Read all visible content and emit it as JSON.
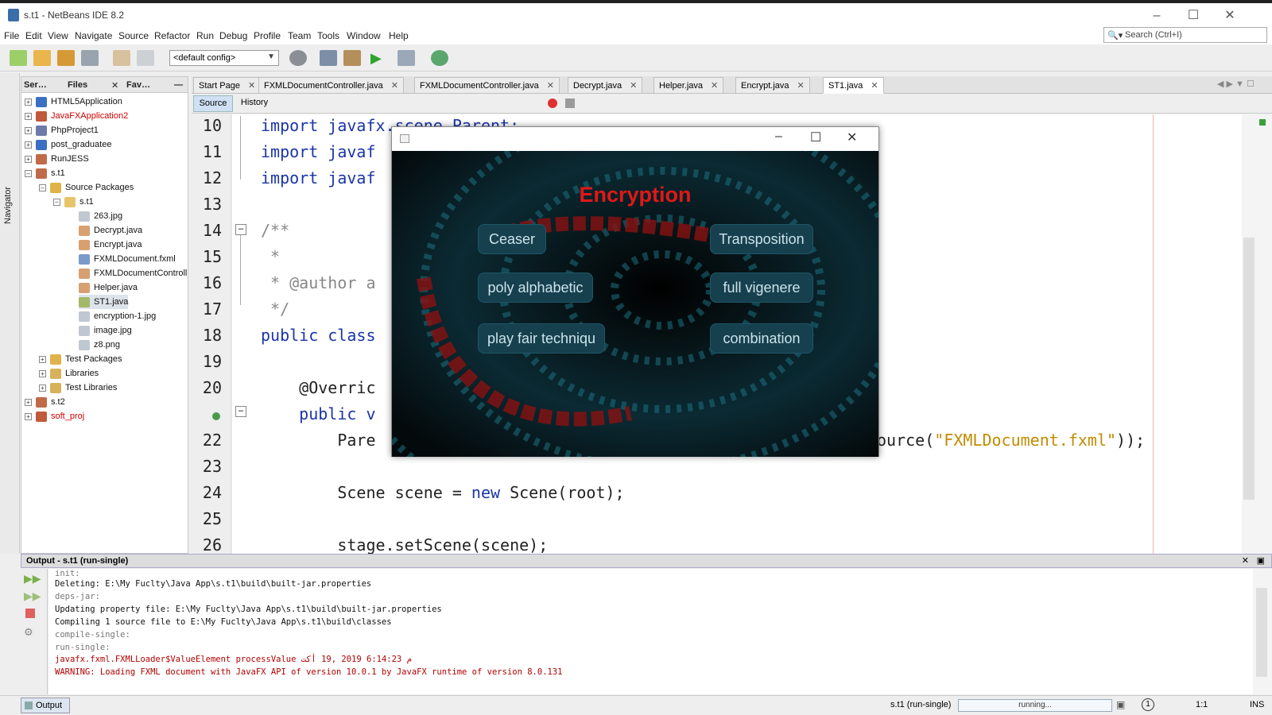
{
  "window": {
    "title": "s.t1 - NetBeans IDE 8.2"
  },
  "menu": [
    "File",
    "Edit",
    "View",
    "Navigate",
    "Source",
    "Refactor",
    "Run",
    "Debug",
    "Profile",
    "Team",
    "Tools",
    "Window",
    "Help"
  ],
  "search": {
    "placeholder": "Search (Ctrl+I)"
  },
  "toolbar": {
    "config": "<default config>"
  },
  "side": {
    "navigator": "Navigator"
  },
  "panel": {
    "tabs": [
      "Ser…",
      "Files",
      "Fav…"
    ]
  },
  "tree": [
    {
      "label": "HTML5Application",
      "red": false
    },
    {
      "label": "JavaFXApplication2",
      "red": true
    },
    {
      "label": "PhpProject1",
      "red": false
    },
    {
      "label": "post_graduatee",
      "red": false
    },
    {
      "label": "RunJESS",
      "red": false
    },
    {
      "label": "s.t1",
      "red": false
    },
    {
      "label": "Source Packages",
      "red": false
    },
    {
      "label": "s.t1",
      "red": false
    },
    {
      "label": "263.jpg",
      "red": false
    },
    {
      "label": "Decrypt.java",
      "red": false
    },
    {
      "label": "Encrypt.java",
      "red": false
    },
    {
      "label": "FXMLDocument.fxml",
      "red": false
    },
    {
      "label": "FXMLDocumentControll",
      "red": false
    },
    {
      "label": "Helper.java",
      "red": false
    },
    {
      "label": "ST1.java",
      "red": false
    },
    {
      "label": "encryption-1.jpg",
      "red": false
    },
    {
      "label": "image.jpg",
      "red": false
    },
    {
      "label": "z8.png",
      "red": false
    },
    {
      "label": "Test Packages",
      "red": false
    },
    {
      "label": "Libraries",
      "red": false
    },
    {
      "label": "Test Libraries",
      "red": false
    },
    {
      "label": "s.t2",
      "red": false
    },
    {
      "label": "soft_proj",
      "red": true
    }
  ],
  "editor": {
    "tabs": [
      "Start Page",
      "FXMLDocumentController.java",
      "FXMLDocumentController.java",
      "Decrypt.java",
      "Helper.java",
      "Encrypt.java",
      "ST1.java"
    ],
    "source_label": "Source",
    "history_label": "History",
    "line_numbers": [
      "10",
      "11",
      "12",
      "13",
      "14",
      "15",
      "16",
      "17",
      "18",
      "19",
      "20",
      "",
      "22",
      "23",
      "24",
      "25",
      "26"
    ],
    "code": {
      "l10": "import javafx.scene.Parent;",
      "l11": "import javaf",
      "l12": "import javaf",
      "l14": "/**",
      "l15": " *",
      "l16": " * @author a",
      "l17": " */",
      "l18_kw": "public class",
      "l20": "    @Overric",
      "l21_kw": "    public v",
      "l22_a": "        Pare",
      "l22_b": "ource(",
      "l22_str": "\"FXMLDocument.fxml\"",
      "l22_c": "));",
      "l24_a": "        Scene scene = ",
      "l24_kw": "new",
      "l24_b": " Scene(root);",
      "l26": "        stage.setScene(scene);"
    }
  },
  "output": {
    "header": "Output - s.t1 (run-single)",
    "lines": [
      {
        "text": "init:",
        "cls": "gray"
      },
      {
        "text": "Deleting: E:\\My Fuclty\\Java App\\s.t1\\build\\built-jar.properties",
        "cls": ""
      },
      {
        "text": "deps-jar:",
        "cls": "gray"
      },
      {
        "text": "Updating property file: E:\\My Fuclty\\Java App\\s.t1\\build\\built-jar.properties",
        "cls": ""
      },
      {
        "text": "Compiling 1 source file to E:\\My Fuclty\\Java App\\s.t1\\build\\classes",
        "cls": ""
      },
      {
        "text": "compile-single:",
        "cls": "gray"
      },
      {
        "text": "run-single:",
        "cls": "gray"
      },
      {
        "text": "javafx.fxml.FXMLLoader$ValueElement processValue م 6:14:23 2019 ,19 أكت",
        "cls": "red"
      },
      {
        "text": "WARNING: Loading FXML document with JavaFX API of version 10.0.1 by JavaFX runtime of version 8.0.131",
        "cls": "red"
      }
    ]
  },
  "status": {
    "output_tab": "Output",
    "task": "s.t1 (run-single)",
    "progress": "running...",
    "position": "1:1",
    "mode": "INS"
  },
  "dialog": {
    "title_text": "Encryption",
    "buttons": [
      "Ceaser",
      "Transposition",
      "poly alphabetic",
      "full vigenere",
      "play fair techniqu",
      "combination"
    ],
    "colors": {
      "title": "#e01818",
      "button_bg": "#16404e",
      "button_text": "#cde3ea"
    }
  }
}
